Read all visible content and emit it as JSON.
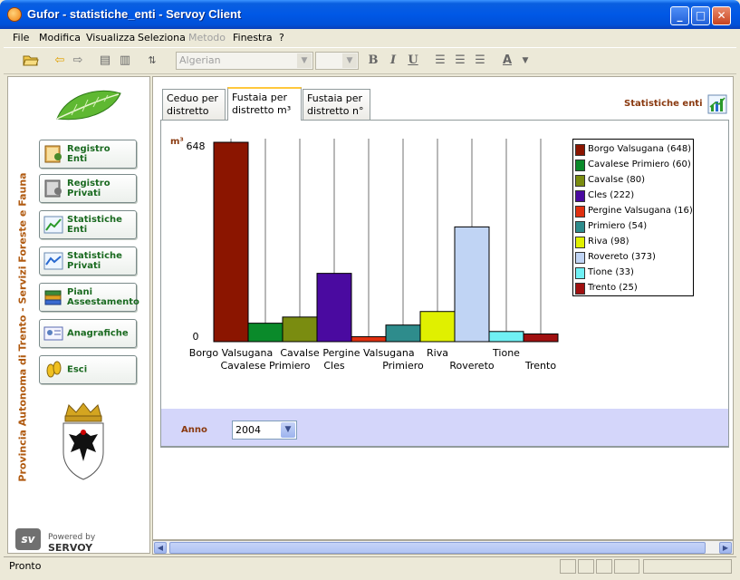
{
  "window": {
    "title": "Gufor - statistiche_enti - Servoy Client"
  },
  "menu": [
    {
      "label": "File",
      "disabled": false
    },
    {
      "label": "Modifica",
      "disabled": false
    },
    {
      "label": "Visualizza",
      "disabled": false
    },
    {
      "label": "Seleziona",
      "disabled": false
    },
    {
      "label": "Metodo",
      "disabled": true
    },
    {
      "label": "Finestra",
      "disabled": false
    },
    {
      "label": "?",
      "disabled": false
    }
  ],
  "toolbar": {
    "font": "Algerian",
    "size": "",
    "bold": "B",
    "italic": "I",
    "underline": "U",
    "color": "A"
  },
  "sidebar": {
    "vertical_title": "Provincia Autonoma di Trento - Servizi Foreste e Fauna",
    "buttons": [
      {
        "label1": "Registro",
        "label2": "Enti"
      },
      {
        "label1": "Registro",
        "label2": "Privati"
      },
      {
        "label1": "Statistiche",
        "label2": "Enti"
      },
      {
        "label1": "Statistiche",
        "label2": "Privati"
      },
      {
        "label1": "Piani",
        "label2": "Assestamento"
      },
      {
        "label1": "Anagrafiche",
        "label2": ""
      },
      {
        "label1": "Esci",
        "label2": ""
      }
    ],
    "powered": "Powered by",
    "servoy": "SERVOY"
  },
  "tabs": [
    {
      "line1": "Ceduo per",
      "line2": "distretto"
    },
    {
      "line1": "Fustaia per",
      "line2": "distretto m³"
    },
    {
      "line1": "Fustaia per",
      "line2": "distretto n°"
    }
  ],
  "active_tab": 1,
  "header": {
    "title": "Statistiche enti"
  },
  "filter": {
    "label": "Anno",
    "value": "2004"
  },
  "status": {
    "text": "Pronto"
  },
  "chart_data": {
    "type": "bar",
    "ylabel": "m³",
    "ylim": [
      0,
      648
    ],
    "yticks": [
      0,
      648
    ],
    "categories": [
      "Borgo Valsugana",
      "Cavalese Primiero",
      "Cavalse",
      "Cles",
      "Pergine Valsugana",
      "Primiero",
      "Riva",
      "Rovereto",
      "Tione",
      "Trento"
    ],
    "values": [
      648,
      60,
      80,
      222,
      16,
      54,
      98,
      373,
      33,
      25
    ],
    "colors": [
      "#8b1500",
      "#0a8a2a",
      "#7a8c10",
      "#4a0aa0",
      "#e03010",
      "#2e8c8c",
      "#e0f000",
      "#c0d4f4",
      "#70f0f4",
      "#a01010"
    ],
    "legend": [
      "Borgo Valsugana (648)",
      "Cavalese Primiero (60)",
      "Cavalse (80)",
      "Cles (222)",
      "Pergine Valsugana (16)",
      "Primiero (54)",
      "Riva (98)",
      "Rovereto (373)",
      "Tione (33)",
      "Trento (25)"
    ],
    "legend_position": "right",
    "grid": false
  }
}
